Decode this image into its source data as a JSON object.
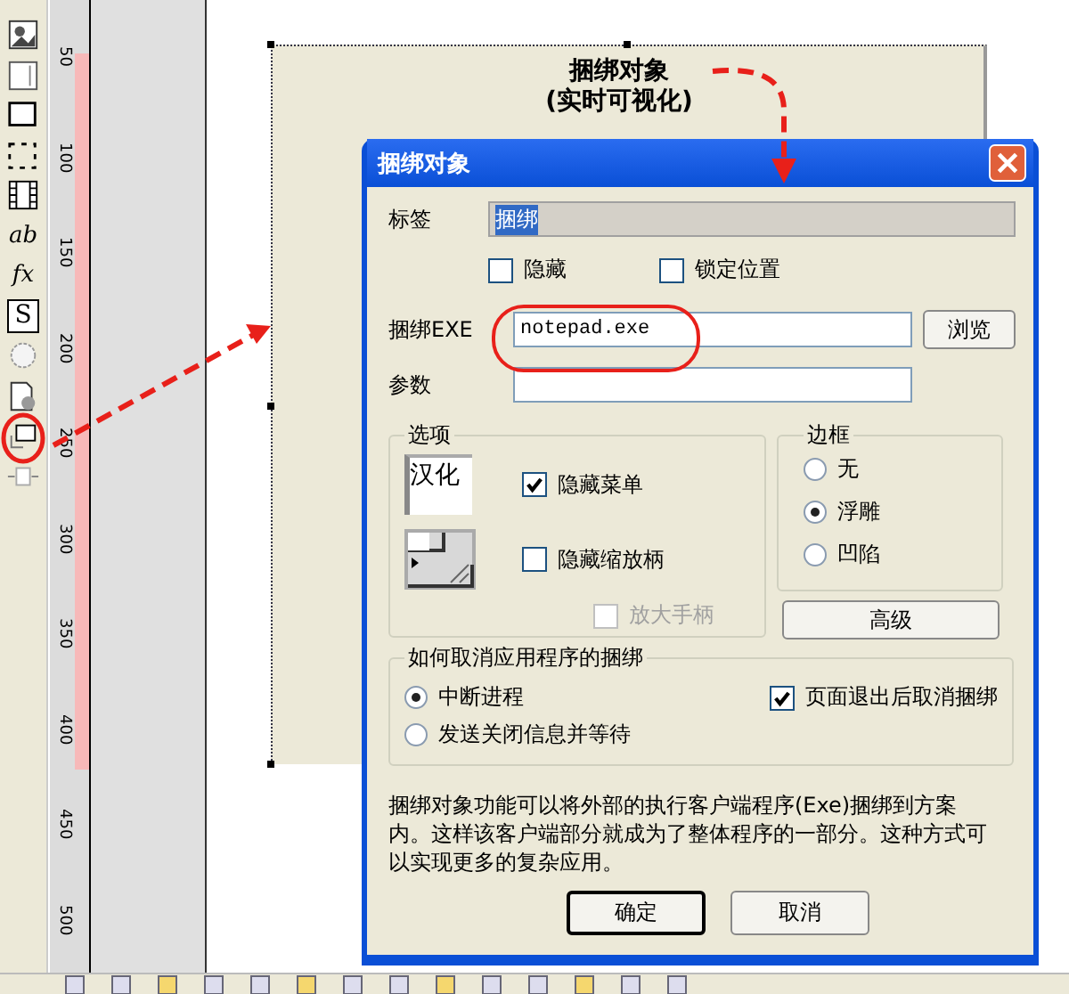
{
  "toolbar": {
    "tools": [
      {
        "kind": "image"
      },
      {
        "kind": "list"
      },
      {
        "kind": "rect"
      },
      {
        "kind": "dashed"
      },
      {
        "kind": "film"
      },
      {
        "kind": "text",
        "glyph": "ab"
      },
      {
        "kind": "text",
        "glyph": "fx"
      },
      {
        "kind": "boxed",
        "glyph": "S"
      },
      {
        "kind": "globe"
      },
      {
        "kind": "doc"
      },
      {
        "kind": "bind",
        "highlighted": true
      },
      {
        "kind": "resize"
      }
    ]
  },
  "ruler": {
    "ticks": [
      "50",
      "100",
      "150",
      "200",
      "250",
      "300",
      "350",
      "400",
      "450",
      "500"
    ]
  },
  "canvas": {
    "object_title": "捆绑对象",
    "object_subtitle": "(实时可视化)"
  },
  "dialog": {
    "title": "捆绑对象",
    "label_field": {
      "label": "标签",
      "value": "捆绑",
      "disabled": true
    },
    "checks": [
      {
        "label": "隐藏",
        "checked": false
      },
      {
        "label": "锁定位置",
        "checked": false
      }
    ],
    "exe_field": {
      "label": "捆绑EXE",
      "value": "notepad.exe",
      "highlighted": true
    },
    "browse_button": "浏览",
    "params_field": {
      "label": "参数"
    },
    "options": {
      "title": "选项",
      "preview_text": "汉化",
      "checks": [
        {
          "label": "隐藏菜单",
          "checked": true,
          "disabled": false
        },
        {
          "label": "隐藏缩放柄",
          "checked": false,
          "disabled": false
        },
        {
          "label": "放大手柄",
          "checked": false,
          "disabled": true
        }
      ]
    },
    "border": {
      "title": "边框",
      "radios": [
        {
          "label": "无",
          "selected": false
        },
        {
          "label": "浮雕",
          "selected": true
        },
        {
          "label": "凹陷",
          "selected": false
        }
      ]
    },
    "advanced_button": "高级",
    "unbind": {
      "title": "如何取消应用程序的捆绑",
      "radios": [
        {
          "label": "中断进程",
          "selected": true
        },
        {
          "label": "发送关闭信息并等待",
          "selected": false
        }
      ],
      "check": {
        "label": "页面退出后取消捆绑",
        "checked": true
      }
    },
    "description": "捆绑对象功能可以将外部的执行客户端程序(Exe)捆绑到方案内。这样该客户端部分就成为了整体程序的一部分。这种方式可以实现更多的复杂应用。",
    "buttons": [
      "确定",
      "取消"
    ]
  }
}
